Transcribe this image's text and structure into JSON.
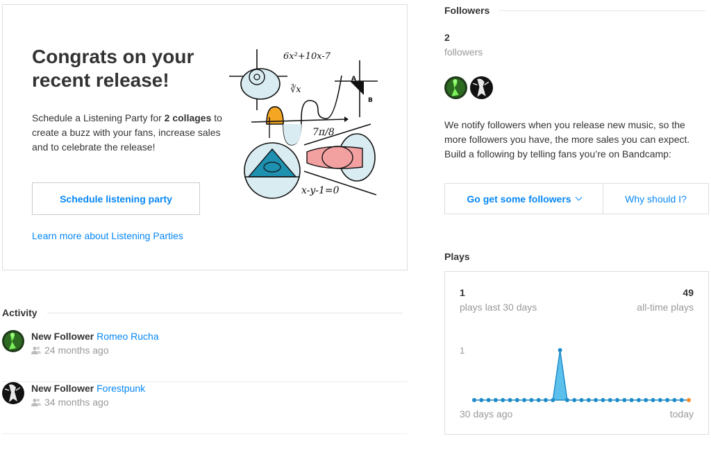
{
  "promo": {
    "title": "Congrats on your recent release!",
    "text_before": "Schedule a Listening Party for ",
    "text_bold": "2 collages",
    "text_after": " to create a buzz with your fans, increase sales and to celebrate the release!",
    "button_label": "Schedule listening party",
    "link_label": "Learn more about Listening Parties",
    "art_equation_1": "6x²+10x-7",
    "art_equation_2": "∛x",
    "art_equation_3": "7π/8",
    "art_equation_4": "x-y-1=0",
    "art_label_a": "A",
    "art_label_b": "B"
  },
  "activity": {
    "heading": "Activity",
    "items": [
      {
        "type": "New Follower",
        "name": "Romeo Rucha",
        "time": "24 months ago",
        "avatar": "green-figure-avatar"
      },
      {
        "type": "New Follower",
        "name": "Forestpunk",
        "time": "34 months ago",
        "avatar": "white-figure-avatar"
      }
    ]
  },
  "followers": {
    "heading": "Followers",
    "count": "2",
    "count_label": "followers",
    "description": "We notify followers when you release new music, so the more followers you have, the more sales you can expect. Build a following by telling fans you’re on Bandcamp:",
    "primary_button": "Go get some followers",
    "secondary_button": "Why should I?"
  },
  "plays": {
    "heading": "Plays",
    "recent_count": "1",
    "recent_label": "plays last 30 days",
    "alltime_count": "49",
    "alltime_label": "all-time plays",
    "start_label": "30 days ago",
    "end_label": "today",
    "y_tick": "1"
  },
  "chart_data": {
    "type": "area",
    "x": [
      "30 days ago",
      "",
      "",
      "",
      "",
      "",
      "",
      "",
      "",
      "",
      "",
      "",
      "",
      "",
      "",
      "",
      "",
      "",
      "",
      "",
      "",
      "",
      "",
      "",
      "",
      "",
      "",
      "",
      "",
      "",
      "today"
    ],
    "values": [
      0,
      0,
      0,
      0,
      0,
      0,
      0,
      0,
      0,
      0,
      0,
      0,
      1,
      0,
      0,
      0,
      0,
      0,
      0,
      0,
      0,
      0,
      0,
      0,
      0,
      0,
      0,
      0,
      0,
      0,
      0
    ],
    "ylim": [
      0,
      1
    ],
    "y_ticks": [
      "1"
    ],
    "colors": {
      "area": "#5bc0eb",
      "point": "#1f8bc8",
      "last_point": "#f28e2b"
    }
  },
  "colors": {
    "link": "#0687f5",
    "border": "#dddddd",
    "muted": "#999999"
  }
}
